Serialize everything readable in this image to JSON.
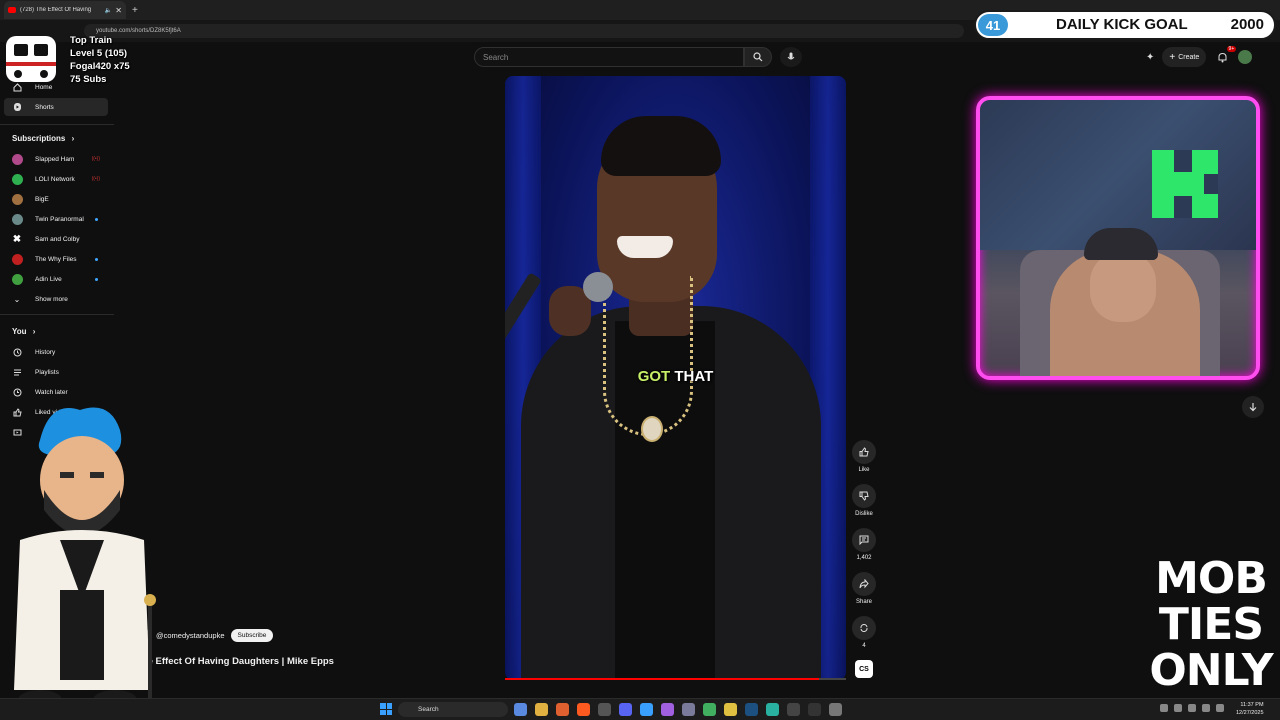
{
  "browser": {
    "tab_title": "(728) The Effect Of Having",
    "url": "youtube.com/shorts/DZ8K5fjt6A"
  },
  "header": {
    "search_placeholder": "Search",
    "create_label": "Create",
    "notif_count": "9+"
  },
  "sidebar": {
    "items": [
      {
        "label": "Home",
        "icon": "home-icon"
      },
      {
        "label": "Shorts",
        "icon": "shorts-icon"
      }
    ],
    "subscriptions_label": "Subscriptions",
    "subscriptions": [
      {
        "label": "Slapped Ham",
        "color": "#b04a8a",
        "live": true
      },
      {
        "label": "LOLI Network",
        "color": "#2fb050",
        "live": true
      },
      {
        "label": "BigE",
        "color": "#a07040",
        "live": false
      },
      {
        "label": "Twin Paranormal",
        "color": "#6a8a8a",
        "dot": true
      },
      {
        "label": "Sam and Colby",
        "color": "#ffffff",
        "live": false
      },
      {
        "label": "The Why Files",
        "color": "#c02020",
        "dot": true
      },
      {
        "label": "Adin Live",
        "color": "#40a040",
        "dot": true
      }
    ],
    "show_more": "Show more",
    "you_label": "You",
    "you_items": [
      {
        "label": "History",
        "icon": "history-icon"
      },
      {
        "label": "Playlists",
        "icon": "playlist-icon"
      },
      {
        "label": "Watch later",
        "icon": "clock-icon"
      },
      {
        "label": "Liked videos",
        "icon": "thumb-up-icon"
      }
    ]
  },
  "overlays": {
    "train_lines": [
      "Top Train",
      "Level 5  (105)",
      "Fogal420 x75",
      "75 Subs"
    ],
    "kick_count": "41",
    "kick_label": "DAILY KICK GOAL",
    "kick_target": "2000",
    "mob_lines": [
      "MOB",
      "TIES",
      "ONLY"
    ]
  },
  "video": {
    "caption_highlight": "GOT",
    "caption_rest": " THAT",
    "progress": 0.92,
    "channel": "@comedystandupke",
    "subscribe_label": "Subscribe",
    "title": "The Effect Of Having Daughters | Mike Epps"
  },
  "actions": {
    "like": "Like",
    "dislike": "Dislike",
    "comments": "1,402",
    "share": "Share",
    "remix": "4"
  },
  "taskbar": {
    "search_label": "Search",
    "time": "11:37 PM",
    "date": "12/27/2025"
  }
}
